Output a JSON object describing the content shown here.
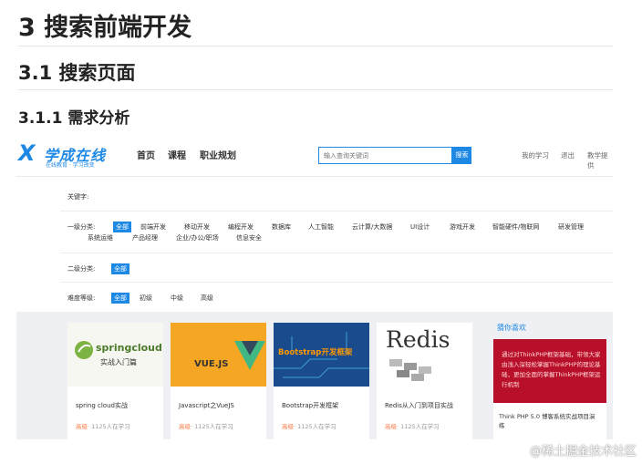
{
  "doc": {
    "h1": "3 搜索前端开发",
    "h2": "3.1 搜索页面",
    "h3": "3.1.1 需求分析"
  },
  "site": {
    "logo_mark": "X",
    "logo_name": "学成在线",
    "logo_sub": "在线教育 · 学习改变",
    "nav": [
      "首页",
      "课程",
      "职业规划"
    ],
    "search_placeholder": "输入查询关键词",
    "search_button": "搜索",
    "top_links": [
      "我的学习",
      "退出",
      "教学提供"
    ]
  },
  "filters": {
    "keyword_label": "关键字:",
    "category1_label": "一级分类:",
    "category1_items": [
      "全部",
      "前端开发",
      "移动开发",
      "编程开发",
      "数据库",
      "人工智能",
      "云计算/大数据",
      "UI设计",
      "游戏开发",
      "智能硬件/物联网",
      "研发管理",
      "系统运维",
      "产品经理",
      "企业/办公/职场",
      "信息安全"
    ],
    "category2_label": "二级分类:",
    "category2_items": [
      "全部"
    ],
    "level_label": "难度等级:",
    "level_items": [
      "全部",
      "初级",
      "中级",
      "高级"
    ]
  },
  "courses": [
    {
      "thumb_text": "springcloud",
      "thumb_sub": "实战入门篇",
      "title": "spring cloud实战",
      "level": "高级",
      "meta": "· 1125人在学习"
    },
    {
      "thumb_text": "VUE.JS",
      "thumb_sub": "",
      "title": "Javascript之VueJS",
      "level": "高级",
      "meta": "· 1125人在学习"
    },
    {
      "thumb_text": "Bootstrap开发框架",
      "thumb_sub": "",
      "title": "Bootstrap开发框架",
      "level": "高级",
      "meta": "· 1125人在学习"
    },
    {
      "thumb_text": "Redis",
      "thumb_sub": "",
      "title": "Redis从入门到项目实战",
      "level": "高级",
      "meta": "· 1125人在学习"
    }
  ],
  "recommend": {
    "title": "猜你喜欢",
    "img_text": "通过对ThinkPHP框架基础，带领大家由浅入深轻松掌握ThinkPHP的理论基础，更加全面的掌握ThinkPHP框架运行机制",
    "caption": "Think PHP 5.0 博客系统实战项目演练"
  },
  "watermark": "@稀土掘金技术社区",
  "colors": {
    "accent": "#1e88e5",
    "level": "#ff7a45",
    "rec_bg": "#b8102a"
  }
}
